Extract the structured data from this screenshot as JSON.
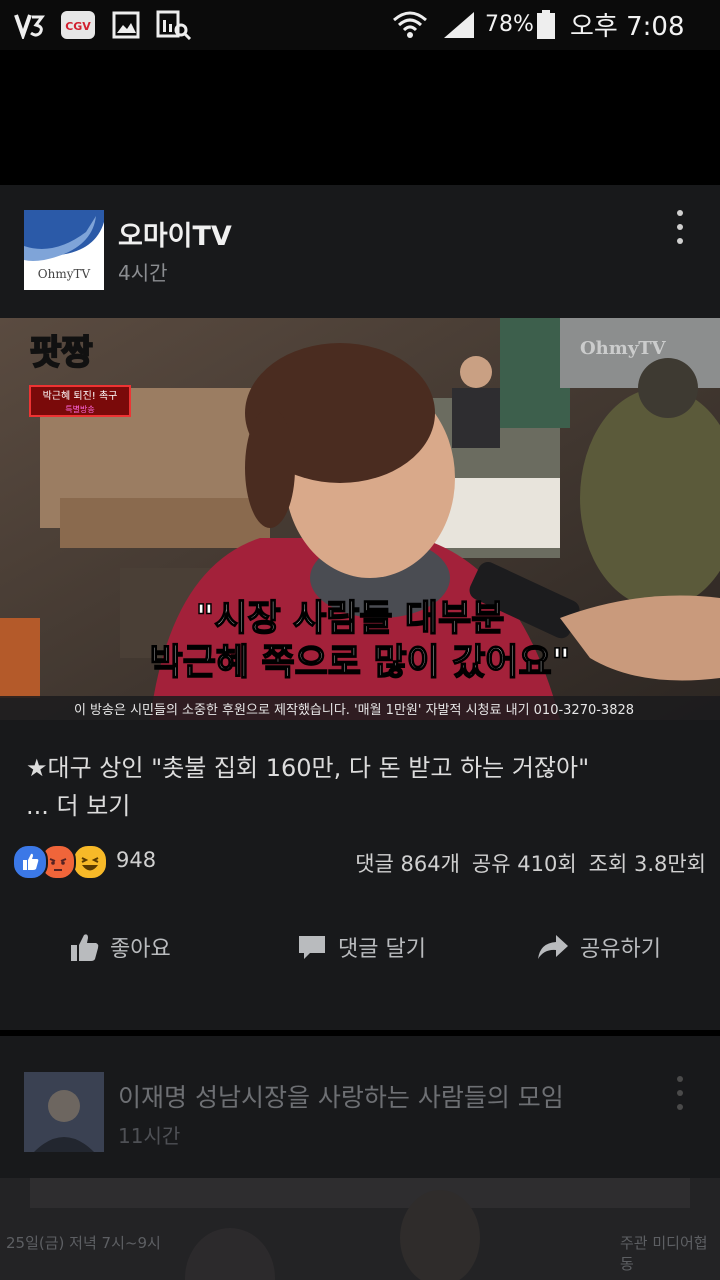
{
  "status_bar": {
    "battery": "78%",
    "time": "오후 7:08",
    "cgv_label": "CGV",
    "icons": [
      "v3-app-icon",
      "cgv-app-icon",
      "gallery-icon",
      "search-doc-icon",
      "wifi-icon",
      "signal-icon",
      "battery-icon"
    ]
  },
  "post": {
    "page_name": "오마이TV",
    "time": "4시간",
    "avatar_logo_text": "OhmyTV",
    "video": {
      "show_logo": "팟짱",
      "program_tag": "박근혜 퇴진! 촉구",
      "program_sub": "특별방송",
      "watermark": "OhmyTV",
      "subtitle_line1": "\"시장 사람들 대부분",
      "subtitle_line2": "박근혜 쪽으로 많이 갔어요\"",
      "ticker": "이 방송은 시민들의 소중한 후원으로 제작했습니다. '매월 1만원' 자발적 시청료 내기 010-3270-3828"
    },
    "caption": "★대구 상인 \"촛불 집회 160만, 다 돈 받고 하는 거잖아\"",
    "see_more": "... 더 보기",
    "reaction_count": "948",
    "comments": "댓글 864개",
    "shares": "공유 410회",
    "views": "조회 3.8만회",
    "actions": {
      "like": "좋아요",
      "comment": "댓글 달기",
      "share": "공유하기"
    }
  },
  "next_post": {
    "page_name": "이재명 성남시장을 사랑하는 사람들의 모임",
    "time": "11시간",
    "banner_left": "25일(금) 저녁 7시~9시",
    "banner_right": "주관  미디어협동"
  },
  "colors": {
    "background": "#000000",
    "card": "#18191b",
    "like_blue": "#3b78e7",
    "angry_orange": "#f0653a",
    "haha_yellow": "#f7b928"
  }
}
